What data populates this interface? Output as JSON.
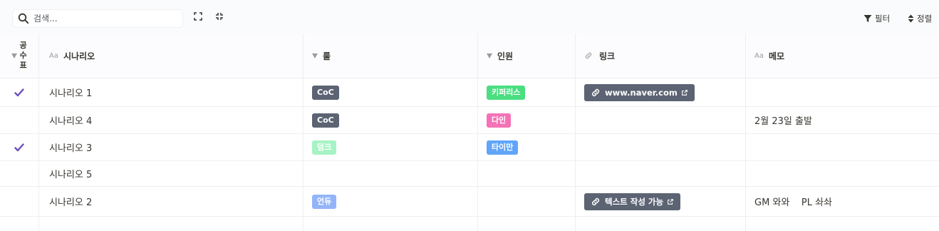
{
  "search": {
    "placeholder": "검색..."
  },
  "toolbar": {
    "filter_label": "필터",
    "sort_label": "정렬"
  },
  "columns": [
    {
      "label": "공수표",
      "chars": [
        "공",
        "수",
        "표"
      ],
      "type": "select"
    },
    {
      "label": "시나리오",
      "type": "text",
      "type_icon": "Aa"
    },
    {
      "label": "룰",
      "type": "select"
    },
    {
      "label": "인원",
      "type": "select"
    },
    {
      "label": "링크",
      "type": "url"
    },
    {
      "label": "메모",
      "type": "text",
      "type_icon": "Aa"
    }
  ],
  "rows": [
    {
      "checked": true,
      "name": "시나리오 1",
      "rule": {
        "text": "CoC",
        "color": "#5c6473"
      },
      "member": {
        "text": "키퍼리스",
        "color": "#4ade80"
      },
      "link": "www.naver.com",
      "memo": ""
    },
    {
      "checked": false,
      "name": "시나리오 4",
      "rule": {
        "text": "CoC",
        "color": "#5c6473"
      },
      "member": {
        "text": "다인",
        "color": "#f472b6"
      },
      "link": "",
      "memo": "2월 23일 출발"
    },
    {
      "checked": true,
      "name": "시나리오 3",
      "rule": {
        "text": "덤크",
        "color": "#a7f3c5"
      },
      "member": {
        "text": "타이만",
        "color": "#60a5fa"
      },
      "link": "",
      "memo": ""
    },
    {
      "checked": false,
      "name": "시나리오 5",
      "rule": null,
      "member": null,
      "link": "",
      "memo": ""
    },
    {
      "checked": false,
      "name": "시나리오 2",
      "rule": {
        "text": "언듀",
        "color": "#93b4f8"
      },
      "member": null,
      "link": "텍스트 작성 가능",
      "memo": "GM 와와    PL 솨솨"
    }
  ],
  "colors": {
    "check": "#6b4fbb",
    "link_bg": "#5c6473",
    "grid_line": "#eeeef0"
  }
}
